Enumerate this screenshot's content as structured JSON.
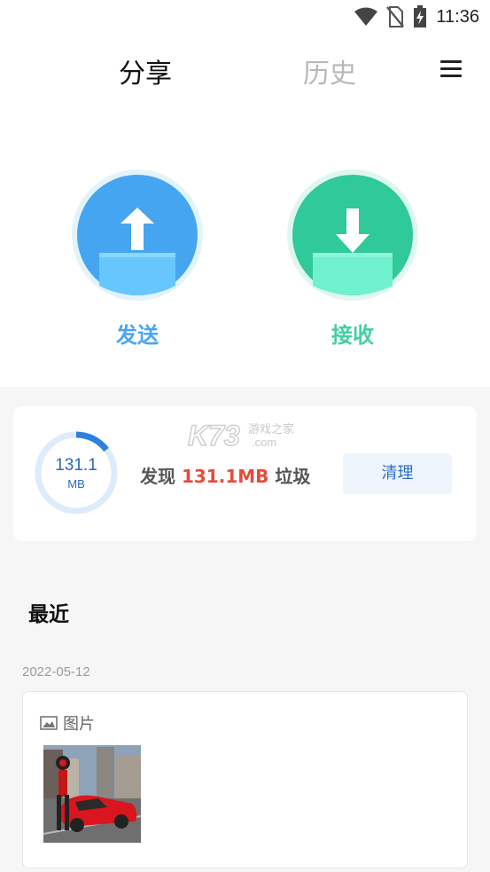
{
  "status_bar": {
    "time": "11:36",
    "icons": [
      "wifi-icon",
      "no-sim-icon",
      "battery-charging-icon"
    ]
  },
  "nav": {
    "tabs": [
      {
        "label": "分享",
        "active": true
      },
      {
        "label": "历史",
        "active": false
      }
    ],
    "menu_icon": "menu-icon"
  },
  "actions": {
    "send": {
      "label": "发送",
      "icon": "upload-folder-icon",
      "color": "#4aa6ee"
    },
    "receive": {
      "label": "接收",
      "icon": "download-folder-icon",
      "color": "#45cfa2"
    }
  },
  "cleaner": {
    "ring_value": "131.1",
    "ring_unit": "MB",
    "msg_prefix": "发现",
    "msg_amount": "131.1MB",
    "msg_suffix": "垃圾",
    "button_label": "清理",
    "accent": "#e84a3a"
  },
  "watermark": {
    "text": "K73",
    "subtext": "游戏之家",
    "domain": ".com"
  },
  "recent": {
    "title": "最近",
    "groups": [
      {
        "date": "2022-05-12",
        "type_label": "图片",
        "type_icon": "image-icon",
        "items": [
          {
            "kind": "image",
            "description": "car-game-screenshot"
          }
        ]
      }
    ]
  }
}
